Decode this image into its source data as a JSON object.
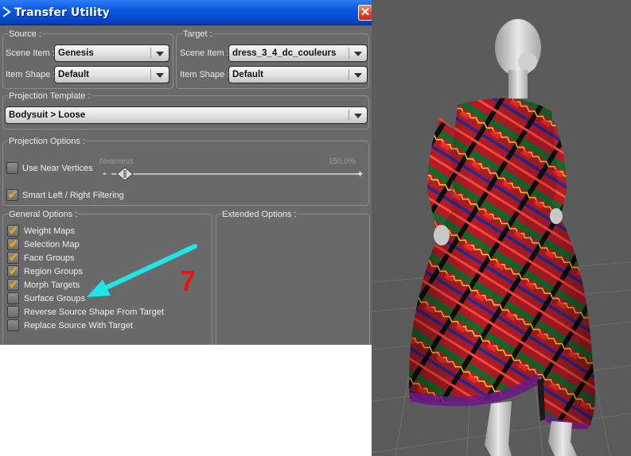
{
  "window": {
    "title": "Transfer Utility",
    "close_icon": "close-icon",
    "app_icon": "daz-app-icon"
  },
  "source": {
    "group_label": "Source :",
    "scene_item_label": "Scene Item :",
    "scene_item_value": "Genesis",
    "item_shape_label": "Item Shape :",
    "item_shape_value": "Default"
  },
  "target": {
    "group_label": "Target :",
    "scene_item_label": "Scene Item :",
    "scene_item_value": "dress_3_4_dc_couleurs",
    "item_shape_label": "Item Shape :",
    "item_shape_value": "Default"
  },
  "projection_template": {
    "group_label": "Projection Template :",
    "value": "Bodysuit > Loose"
  },
  "projection_options": {
    "group_label": "Projection Options :",
    "use_near_vertices": {
      "label": "Use Near Vertices",
      "checked": false
    },
    "nearness": {
      "label": "Nearness",
      "value_text": "150.0%",
      "minus": "-",
      "plus": "+"
    },
    "smart_filtering": {
      "label": "Smart Left / Right Filtering",
      "checked": true
    }
  },
  "general_options": {
    "group_label": "General Options :",
    "items": [
      {
        "label": "Weight Maps",
        "checked": true
      },
      {
        "label": "Selection Map",
        "checked": true
      },
      {
        "label": "Face Groups",
        "checked": true
      },
      {
        "label": "Region Groups",
        "checked": true
      },
      {
        "label": "Morph Targets",
        "checked": true
      },
      {
        "label": "Surface Groups",
        "checked": false
      },
      {
        "label": "Reverse Source Shape From Target",
        "checked": false
      },
      {
        "label": "Replace Source With Target",
        "checked": false
      }
    ]
  },
  "extended_options": {
    "group_label": "Extended Options :"
  },
  "annotation": {
    "number": "7",
    "arrow_color": "#1ee6e6",
    "number_color": "#ee1111"
  },
  "colors": {
    "dialog_bg": "#6a6a6a",
    "titlebar": "#0a58e0",
    "check_accent": "#f2a21a",
    "viewport_bg": "#5b5b5b",
    "dress_red": "#b81e2a",
    "dress_green": "#1e6e2e",
    "figure_skin": "#d8d8d8"
  }
}
